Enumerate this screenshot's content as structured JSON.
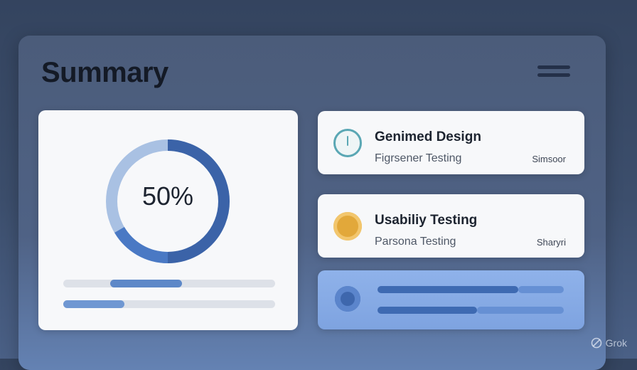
{
  "header": {
    "title": "Summary",
    "menu_icon": "hamburger-menu-icon"
  },
  "progress": {
    "label": "50%",
    "value": 0.5
  },
  "bars": [
    {
      "fill_start": 0.22,
      "fill_end": 0.56
    },
    {
      "fill_start": 0.0,
      "fill_end": 0.29
    }
  ],
  "items": [
    {
      "title": "Genimed Design",
      "subtitle": "Figrsener Testing",
      "meta": "Simsoor",
      "icon": "clock-icon"
    },
    {
      "title": "Usabiliy Testing",
      "subtitle": "Parsona Testing",
      "meta": "Sharyri",
      "icon": "coin-icon"
    }
  ],
  "colors": {
    "accent": "#3b63a8",
    "accent_light": "#a9c1e3",
    "gold": "#e2a83a",
    "teal": "#5aa7b4"
  },
  "watermark": "Grok"
}
